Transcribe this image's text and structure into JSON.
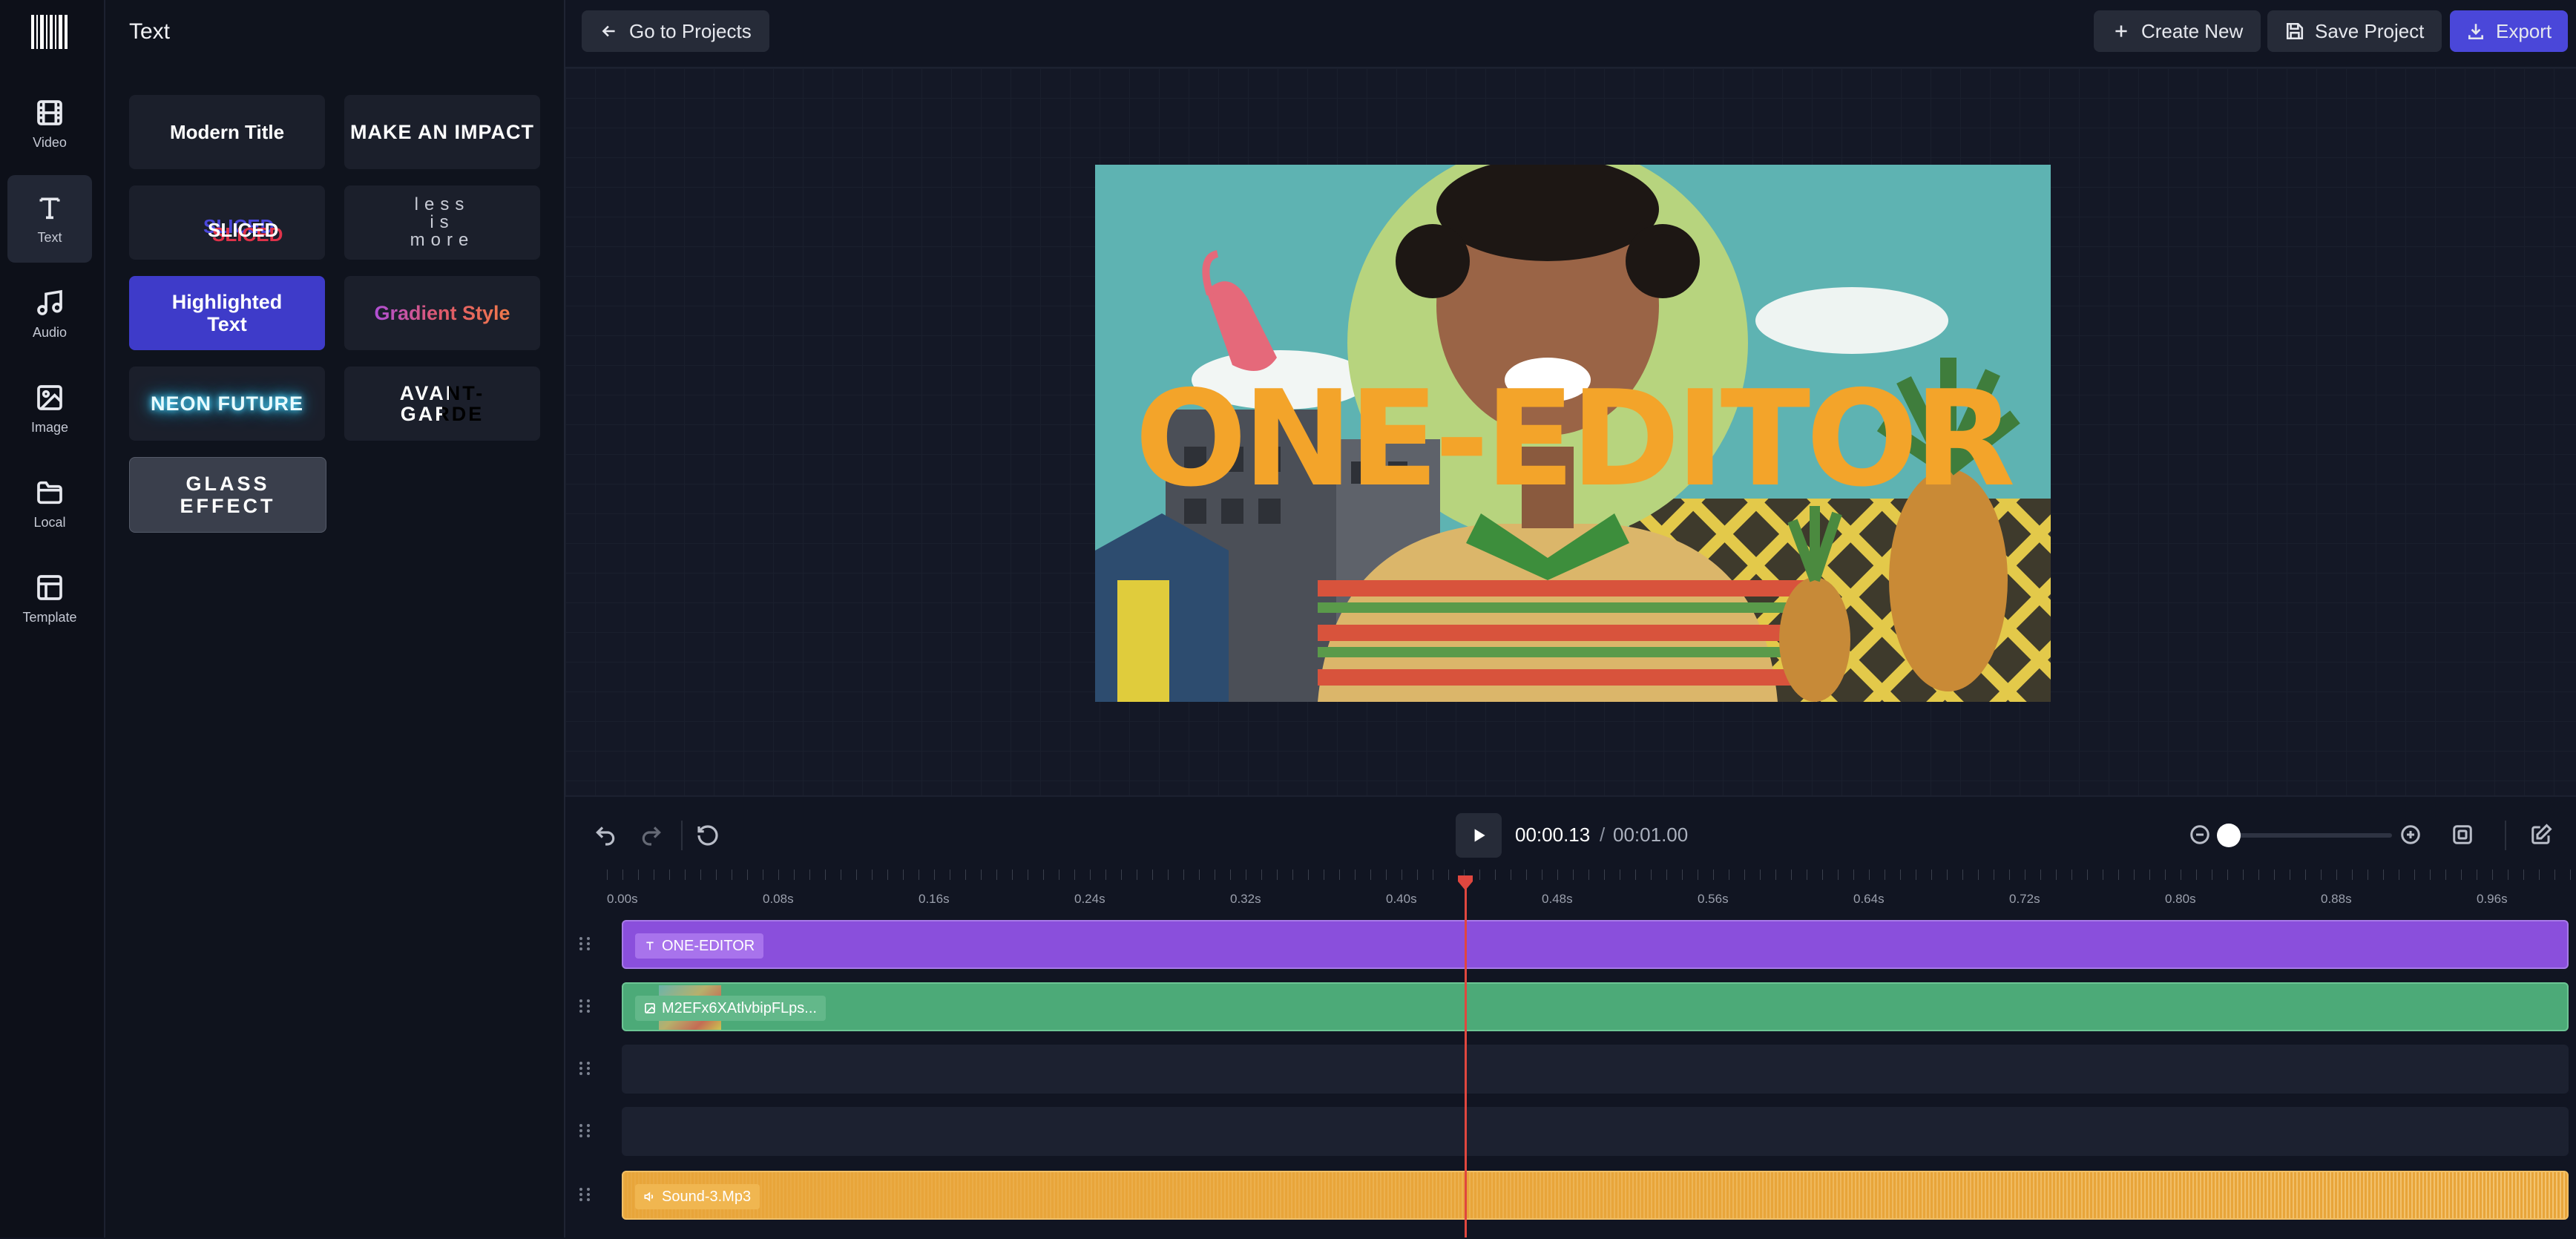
{
  "app": {
    "logo_icon": "barcode-logo-icon"
  },
  "rail": {
    "items": [
      {
        "label": "Video",
        "icon": "film-icon"
      },
      {
        "label": "Text",
        "icon": "text-icon",
        "active": true
      },
      {
        "label": "Audio",
        "icon": "music-icon"
      },
      {
        "label": "Image",
        "icon": "image-icon"
      },
      {
        "label": "Local",
        "icon": "folder-icon"
      },
      {
        "label": "Template",
        "icon": "template-icon"
      }
    ]
  },
  "panel": {
    "title": "Text",
    "cards": [
      {
        "label": "Modern Title"
      },
      {
        "label": "MAKE AN IMPACT"
      },
      {
        "label": "SLICED"
      },
      {
        "label": "less is more",
        "lines": [
          "less",
          "is",
          "more"
        ]
      },
      {
        "label": "Highlighted Text",
        "lines": [
          "Highlighted",
          "Text"
        ]
      },
      {
        "label": "Gradient Style"
      },
      {
        "label": "NEON FUTURE"
      },
      {
        "label": "AVANT-GARDE",
        "lines": [
          "AVANT-",
          "GARDE"
        ]
      },
      {
        "label": "GLASS EFFECT",
        "lines": [
          "GLASS",
          "EFFECT"
        ]
      }
    ]
  },
  "topbar": {
    "back_label": "Go to Projects",
    "create_label": "Create New",
    "save_label": "Save Project",
    "export_label": "Export"
  },
  "preview": {
    "overlay_text": "ONE-EDITOR"
  },
  "player": {
    "current_time": "00:00.13",
    "separator": "/",
    "total_time": "00:01.00",
    "zoom_level": 0.05
  },
  "timeline": {
    "ticks": [
      "0.00s",
      "0.08s",
      "0.16s",
      "0.24s",
      "0.32s",
      "0.40s",
      "0.48s",
      "0.56s",
      "0.64s",
      "0.72s",
      "0.80s",
      "0.88s",
      "0.96s"
    ],
    "playhead_time": 0.433,
    "tracks": [
      {
        "type": "text",
        "label": "ONE-EDITOR",
        "color": "#8a4fdc"
      },
      {
        "type": "image",
        "label": "M2EFx6XAtlvbipFLps...",
        "color": "#4caa78"
      },
      {
        "type": "empty"
      },
      {
        "type": "empty"
      },
      {
        "type": "audio",
        "label": "Sound-3.Mp3",
        "color": "#e8a53a"
      }
    ]
  },
  "colors": {
    "accent": "#4a47d9",
    "playhead": "#e0473f",
    "highlight_card": "#3e3bc9"
  }
}
